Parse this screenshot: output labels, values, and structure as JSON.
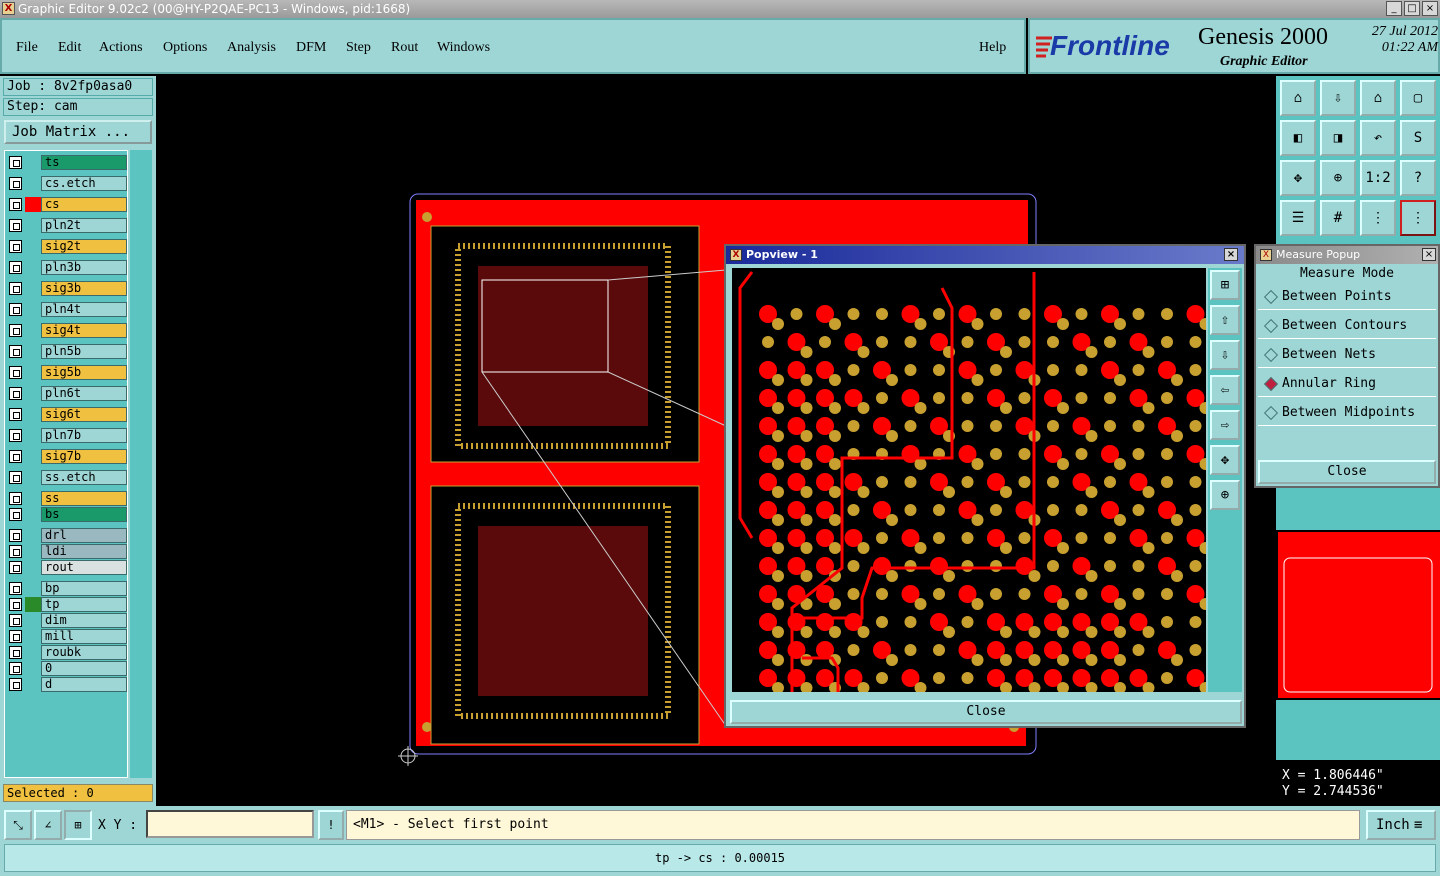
{
  "window": {
    "title": "Graphic Editor 9.02c2 (00@HY-P2QAE-PC13 - Windows, pid:1668)",
    "min": "_",
    "max": "□",
    "close": "×"
  },
  "menu": {
    "items": [
      "File",
      "Edit",
      "Actions",
      "Options",
      "Analysis",
      "DFM",
      "Step",
      "Rout",
      "Windows"
    ],
    "help": "Help"
  },
  "brand": {
    "logo": "Frontline",
    "product": "Genesis 2000",
    "subtitle": "Graphic Editor",
    "date": "27 Jul 2012",
    "time": "01:22 AM"
  },
  "job": {
    "job_label": "Job : 8v2fp0asa0",
    "step_label": "Step: cam",
    "matrix_button": "Job Matrix ..."
  },
  "layers": [
    {
      "name": "ts",
      "color": "#1a9a6a",
      "swatch": ""
    },
    {
      "name": "cs.etch",
      "color": "#9ed6d6",
      "swatch": ""
    },
    {
      "name": "cs",
      "color": "#f0c040",
      "swatch": "#ff0000"
    },
    {
      "name": "pln2t",
      "color": "#9ed6d6",
      "swatch": ""
    },
    {
      "name": "sig2t",
      "color": "#f0c040",
      "swatch": ""
    },
    {
      "name": "pln3b",
      "color": "#9ed6d6",
      "swatch": ""
    },
    {
      "name": "sig3b",
      "color": "#f0c040",
      "swatch": ""
    },
    {
      "name": "pln4t",
      "color": "#9ed6d6",
      "swatch": ""
    },
    {
      "name": "sig4t",
      "color": "#f0c040",
      "swatch": ""
    },
    {
      "name": "pln5b",
      "color": "#9ed6d6",
      "swatch": ""
    },
    {
      "name": "sig5b",
      "color": "#f0c040",
      "swatch": ""
    },
    {
      "name": "pln6t",
      "color": "#9ed6d6",
      "swatch": ""
    },
    {
      "name": "sig6t",
      "color": "#f0c040",
      "swatch": ""
    },
    {
      "name": "pln7b",
      "color": "#9ed6d6",
      "swatch": ""
    },
    {
      "name": "sig7b",
      "color": "#f0c040",
      "swatch": ""
    },
    {
      "name": "ss.etch",
      "color": "#9ed6d6",
      "swatch": ""
    },
    {
      "name": "ss",
      "color": "#f0c040",
      "swatch": ""
    },
    {
      "name": "bs",
      "color": "#1a9a6a",
      "swatch": ""
    },
    {
      "name": "drl",
      "color": "#9ab8c0",
      "swatch": ""
    },
    {
      "name": "ldi",
      "color": "#9ab8c0",
      "swatch": ""
    },
    {
      "name": "rout",
      "color": "#d8e0e0",
      "swatch": ""
    },
    {
      "name": "bp",
      "color": "#9ed6d6",
      "swatch": ""
    },
    {
      "name": "tp",
      "color": "#9ed6d6",
      "swatch": "#2a8a2a"
    },
    {
      "name": "dim",
      "color": "#9ed6d6",
      "swatch": ""
    },
    {
      "name": "mill",
      "color": "#9ed6d6",
      "swatch": ""
    },
    {
      "name": "roubk",
      "color": "#9ed6d6",
      "swatch": ""
    },
    {
      "name": "0",
      "color": "#9ed6d6",
      "swatch": ""
    },
    {
      "name": "d",
      "color": "#9ed6d6",
      "swatch": ""
    }
  ],
  "selected": "Selected : 0",
  "popview": {
    "title": "Popview - 1",
    "close_button": "Close"
  },
  "measure": {
    "title": "Measure Popup",
    "heading": "Measure Mode",
    "options": [
      "Between Points",
      "Between Contours",
      "Between Nets",
      "Annular Ring",
      "Between Midpoints"
    ],
    "selected_option": "Annular Ring",
    "close_button": "Close"
  },
  "coords": {
    "x": "X = 1.806446\"",
    "y": "Y = 2.744536\""
  },
  "status": {
    "xy_label": "X Y :",
    "xy_value": "",
    "prompt": "<M1> - Select first point",
    "unit": "Inch",
    "message": "tp -> cs : 0.00015"
  },
  "tools": {
    "ratio_label": "1:2"
  }
}
